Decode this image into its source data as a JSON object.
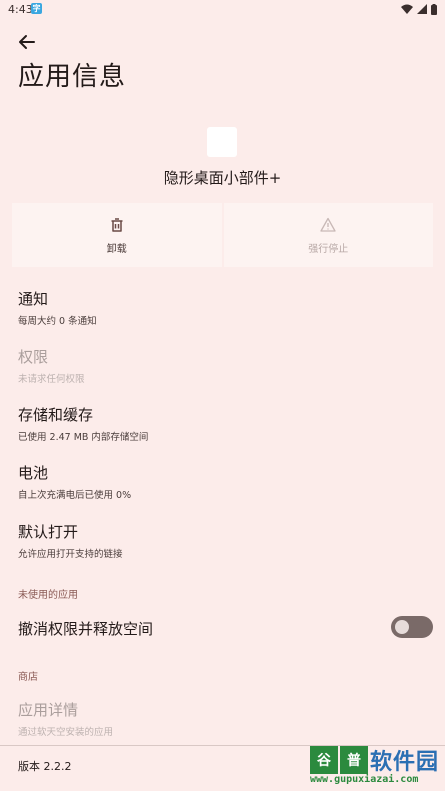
{
  "status_bar": {
    "time": "4:43",
    "notif_glyph": "字"
  },
  "header": {
    "title": "应用信息"
  },
  "app": {
    "name": "隐形桌面小部件+"
  },
  "actions": {
    "uninstall": "卸载",
    "force_stop": "强行停止"
  },
  "items": {
    "notifications": {
      "title": "通知",
      "sub": "每周大约 0 条通知"
    },
    "permissions": {
      "title": "权限",
      "sub": "未请求任何权限"
    },
    "storage": {
      "title": "存储和缓存",
      "sub": "已使用 2.47 MB 内部存储空间"
    },
    "battery": {
      "title": "电池",
      "sub": "自上次充满电后已使用 0%"
    },
    "open_default": {
      "title": "默认打开",
      "sub": "允许应用打开支持的链接"
    },
    "revoke": {
      "title": "撤消权限并释放空间",
      "toggle_on": false
    },
    "app_details": {
      "title": "应用详情",
      "sub": "通过软天空安装的应用"
    }
  },
  "sections": {
    "unused_apps": "未使用的应用",
    "store": "商店"
  },
  "footer": {
    "version": "版本 2.2.2"
  },
  "watermark": {
    "badge1": "谷",
    "badge2": "普",
    "text": "软件园",
    "url": "www.gupuxiazai.com"
  }
}
